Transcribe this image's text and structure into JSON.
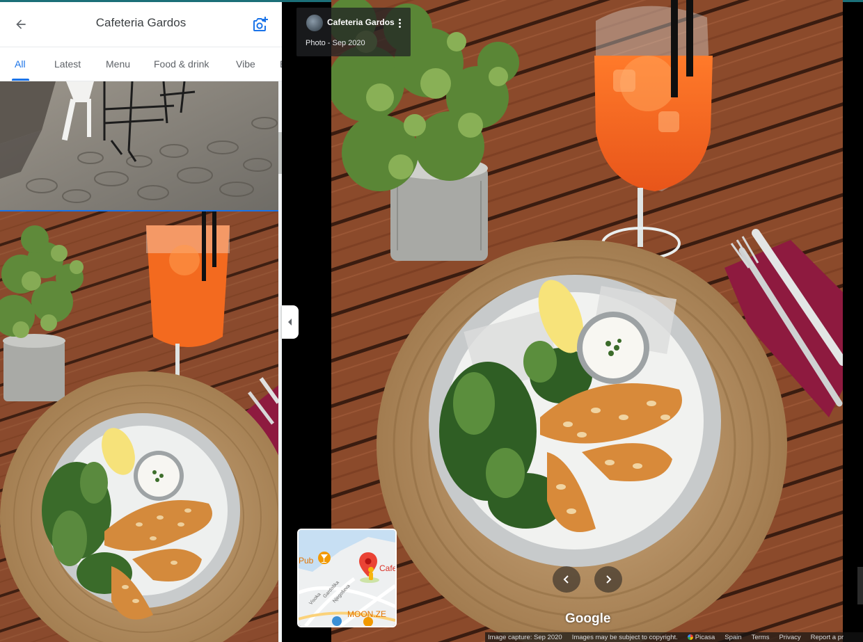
{
  "header": {
    "title": "Cafeteria Gardos"
  },
  "tabs": [
    {
      "label": "All",
      "active": true
    },
    {
      "label": "Latest"
    },
    {
      "label": "Menu"
    },
    {
      "label": "Food & drink"
    },
    {
      "label": "Vibe"
    },
    {
      "label": "B"
    }
  ],
  "info_card": {
    "name": "Cafeteria Gardos",
    "date": "Photo - Sep 2020"
  },
  "minimap": {
    "labels": {
      "pub": "Pub",
      "cafe": "Cafe",
      "moon": "MOON.ZE",
      "street1": "Visoka",
      "street2": "Gardoška",
      "street3": "Njegoševa"
    }
  },
  "viewer": {
    "logo": "Google"
  },
  "footer": {
    "capture": "Image capture: Sep 2020",
    "copyright": "Images may be subject to copyright.",
    "picasa": "Picasa",
    "spain": "Spain",
    "terms": "Terms",
    "privacy": "Privacy",
    "report": "Report a pr"
  },
  "colors": {
    "accent": "#1a73e8",
    "title_text": "#3c4043",
    "tab_text": "#5f6368",
    "drink": "#f36a1f",
    "wood": "#8b4a2b",
    "napkin": "#8e1a3f"
  }
}
